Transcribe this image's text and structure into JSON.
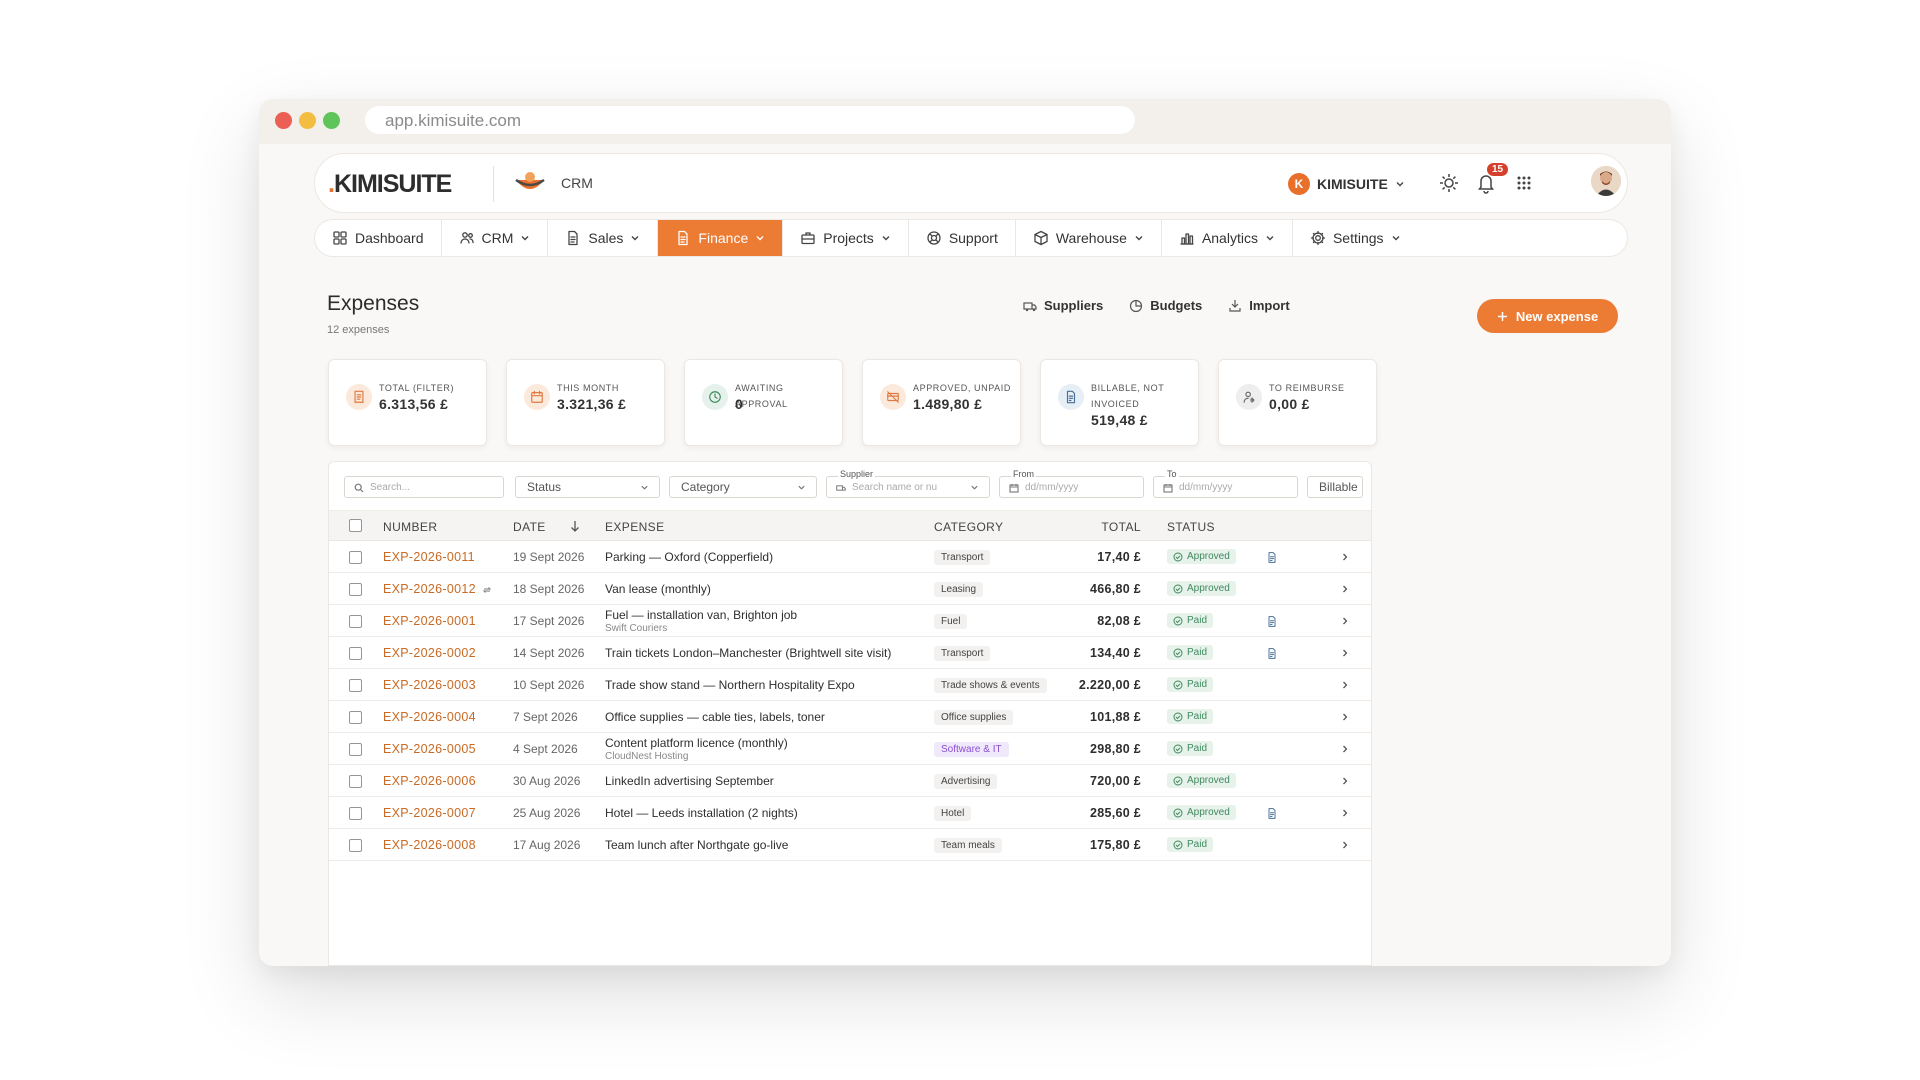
{
  "browser": {
    "url": "app.kimisuite.com"
  },
  "topbar": {
    "logo_text": "KIMISUITE",
    "logo_dot": ".",
    "module": "CRM",
    "tenant_initial": "K",
    "tenant_name": "KIMISUITE",
    "notifications": "15"
  },
  "nav": [
    {
      "label": "Dashboard",
      "icon": "dashboard-icon",
      "dropdown": false,
      "active": false
    },
    {
      "label": "CRM",
      "icon": "people-icon",
      "dropdown": true,
      "active": false
    },
    {
      "label": "Sales",
      "icon": "document-icon",
      "dropdown": true,
      "active": false
    },
    {
      "label": "Finance",
      "icon": "document-icon",
      "dropdown": true,
      "active": true
    },
    {
      "label": "Projects",
      "icon": "briefcase-icon",
      "dropdown": true,
      "active": false
    },
    {
      "label": "Support",
      "icon": "lifebuoy-icon",
      "dropdown": false,
      "active": false
    },
    {
      "label": "Warehouse",
      "icon": "box-icon",
      "dropdown": true,
      "active": false
    },
    {
      "label": "Analytics",
      "icon": "bar-chart-icon",
      "dropdown": true,
      "active": false
    },
    {
      "label": "Settings",
      "icon": "gear-icon",
      "dropdown": true,
      "active": false
    }
  ],
  "page": {
    "title": "Expenses",
    "subtitle": "12 expenses",
    "actions": {
      "suppliers": "Suppliers",
      "budgets": "Budgets",
      "import": "Import"
    },
    "new_button": "New expense"
  },
  "cards": [
    {
      "label": "TOTAL (FILTER)",
      "value": "6.313,56 £",
      "icon": "receipt-icon"
    },
    {
      "label": "THIS MONTH",
      "value": "3.321,36 £",
      "icon": "calendar-icon"
    },
    {
      "label": "AWAITING APPROVAL",
      "value": "0",
      "icon": "clock-icon"
    },
    {
      "label": "APPROVED, UNPAID",
      "value": "1.489,80 £",
      "icon": "no-payment-icon"
    },
    {
      "label": "BILLABLE, NOT INVOICED",
      "value": "519,48 £",
      "icon": "invoice-icon"
    },
    {
      "label": "TO REIMBURSE",
      "value": "0,00 £",
      "icon": "user-refund-icon"
    }
  ],
  "filters": {
    "search_placeholder": "Search...",
    "status": "Status",
    "category": "Category",
    "supplier_label": "Supplier",
    "supplier_placeholder": "Search name or nu",
    "from_label": "From",
    "from_placeholder": "dd/mm/yyyy",
    "to_label": "To",
    "to_placeholder": "dd/mm/yyyy",
    "billable": "Billable"
  },
  "table": {
    "columns": {
      "number": "NUMBER",
      "date": "DATE",
      "expense": "EXPENSE",
      "category": "CATEGORY",
      "total": "TOTAL",
      "status": "STATUS"
    },
    "rows": [
      {
        "number": "EXP-2026-0011",
        "date": "19 Sept 2026",
        "expense": "Parking — Oxford (Copperfield)",
        "sub": "",
        "category": "Transport",
        "total": "17,40 £",
        "status": "Approved",
        "attachment": true,
        "recurring": false
      },
      {
        "number": "EXP-2026-0012",
        "date": "18 Sept 2026",
        "expense": "Van lease (monthly)",
        "sub": "",
        "category": "Leasing",
        "total": "466,80 £",
        "status": "Approved",
        "attachment": false,
        "recurring": true
      },
      {
        "number": "EXP-2026-0001",
        "date": "17 Sept 2026",
        "expense": "Fuel — installation van, Brighton job",
        "sub": "Swift Couriers",
        "category": "Fuel",
        "total": "82,08 £",
        "status": "Paid",
        "attachment": true,
        "recurring": false
      },
      {
        "number": "EXP-2026-0002",
        "date": "14 Sept 2026",
        "expense": "Train tickets London–Manchester (Brightwell site visit)",
        "sub": "",
        "category": "Transport",
        "total": "134,40 £",
        "status": "Paid",
        "attachment": true,
        "recurring": false
      },
      {
        "number": "EXP-2026-0003",
        "date": "10 Sept 2026",
        "expense": "Trade show stand — Northern Hospitality Expo",
        "sub": "",
        "category": "Trade shows & events",
        "total": "2.220,00 £",
        "status": "Paid",
        "attachment": false,
        "recurring": false
      },
      {
        "number": "EXP-2026-0004",
        "date": "7 Sept 2026",
        "expense": "Office supplies — cable ties, labels, toner",
        "sub": "",
        "category": "Office supplies",
        "total": "101,88 £",
        "status": "Paid",
        "attachment": false,
        "recurring": false
      },
      {
        "number": "EXP-2026-0005",
        "date": "4 Sept 2026",
        "expense": "Content platform licence (monthly)",
        "sub": "CloudNest Hosting",
        "category": "Software & IT",
        "total": "298,80 £",
        "status": "Paid",
        "attachment": false,
        "recurring": false
      },
      {
        "number": "EXP-2026-0006",
        "date": "30 Aug 2026",
        "expense": "LinkedIn advertising September",
        "sub": "",
        "category": "Advertising",
        "total": "720,00 £",
        "status": "Approved",
        "attachment": false,
        "recurring": false
      },
      {
        "number": "EXP-2026-0007",
        "date": "25 Aug 2026",
        "expense": "Hotel — Leeds installation (2 nights)",
        "sub": "",
        "category": "Hotel",
        "total": "285,60 £",
        "status": "Approved",
        "attachment": true,
        "recurring": false
      },
      {
        "number": "EXP-2026-0008",
        "date": "17 Aug 2026",
        "expense": "Team lunch after Northgate go-live",
        "sub": "",
        "category": "Team meals",
        "total": "175,80 £",
        "status": "Paid",
        "attachment": false,
        "recurring": false
      }
    ]
  },
  "colors": {
    "accent": "#ec7b34",
    "number_link": "#c96a24",
    "status_green": "#3f8a5e",
    "software_purple": "#8a4fd6"
  }
}
